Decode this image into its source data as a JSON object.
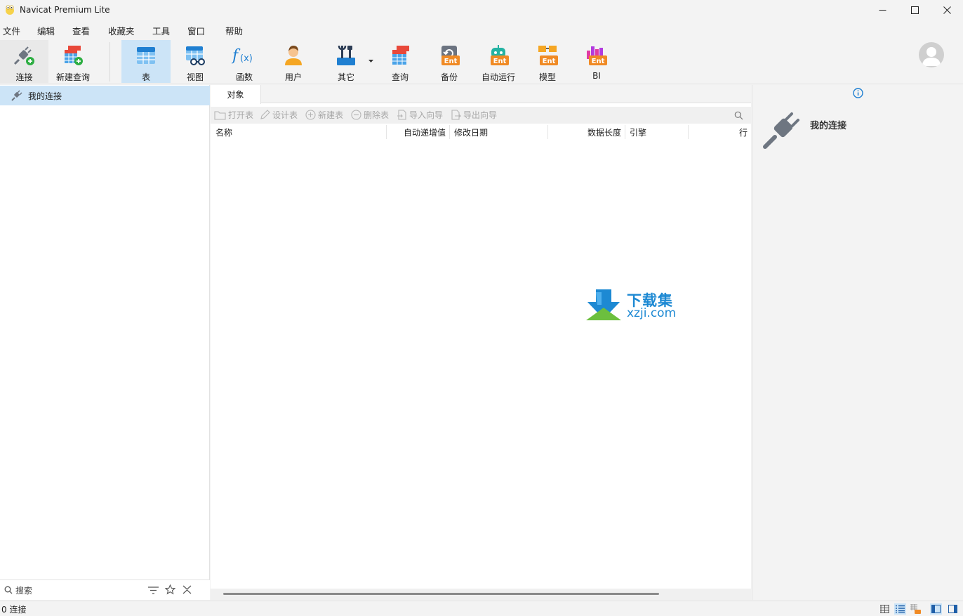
{
  "window": {
    "title": "Navicat Premium Lite"
  },
  "menu": [
    "文件",
    "编辑",
    "查看",
    "收藏夹",
    "工具",
    "窗口",
    "帮助"
  ],
  "toolbar": {
    "connect": "连接",
    "new_query": "新建查询",
    "table": "表",
    "view": "视图",
    "function": "函数",
    "user": "用户",
    "other": "其它",
    "query": "查询",
    "backup": "备份",
    "automation": "自动运行",
    "model": "模型",
    "bi": "BI",
    "ent_badge": "Ent"
  },
  "sidebar": {
    "connection_name": "我的连接",
    "search_placeholder": "搜索"
  },
  "objects": {
    "tab": "对象",
    "actions": {
      "open_table": "打开表",
      "design_table": "设计表",
      "new_table": "新建表",
      "delete_table": "删除表",
      "import_wizard": "导入向导",
      "export_wizard": "导出向导"
    },
    "columns": {
      "name": "名称",
      "auto_increment": "自动递增值",
      "modified_date": "修改日期",
      "data_length": "数据长度",
      "engine": "引擎",
      "rows": "行"
    }
  },
  "info_panel": {
    "connection_name": "我的连接"
  },
  "watermark": {
    "line1": "下载集",
    "line2": "xzji.com"
  },
  "status": {
    "connections": "0 连接"
  },
  "colors": {
    "selected_bg": "#cce4f7",
    "accent_blue": "#1d89d3",
    "ent_orange": "#f08a24"
  }
}
